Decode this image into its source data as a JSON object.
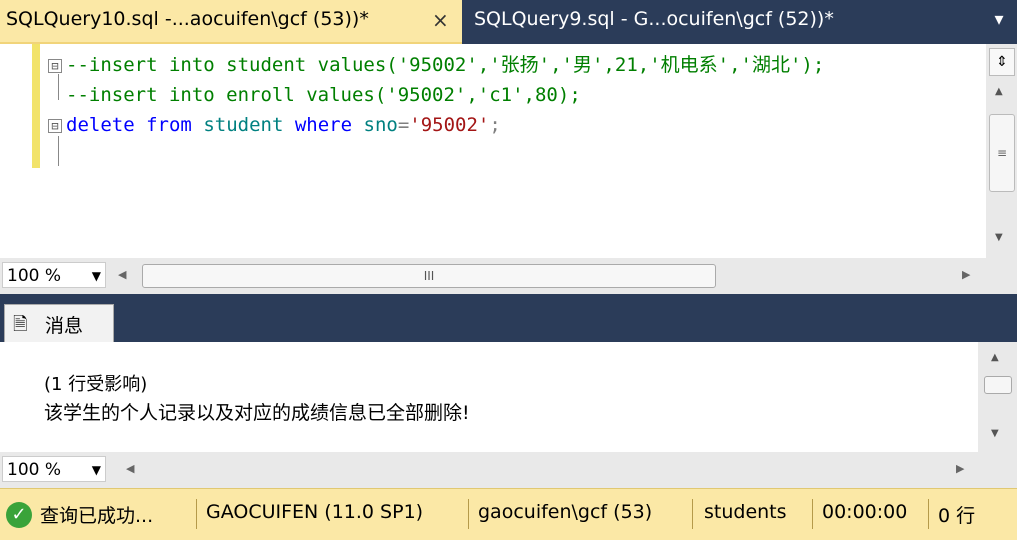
{
  "tabs": {
    "active": "SQLQuery10.sql -...aocuifen\\gcf (53))*",
    "close_icon": "×",
    "inactive": "SQLQuery9.sql - G...ocuifen\\gcf (52))*",
    "menu_icon": "▾"
  },
  "editor": {
    "lines": [
      {
        "fold": "⊟",
        "text": "--insert into student values('95002','张扬','男',21,'机电系','湖北');"
      },
      {
        "text": "--insert into enroll values('95002','c1',80);"
      },
      {
        "fold": "⊟",
        "kw1": "delete",
        "kw2": "from",
        "obj": "student",
        "kw3": "where",
        "obj2": "sno",
        "eq": "=",
        "str": "'95002'",
        "semi": ";"
      }
    ]
  },
  "zoom": {
    "editor": "100 %",
    "results": "100 %"
  },
  "results": {
    "tab_label": "消息",
    "messages": [
      "(1 行受影响)",
      "该学生的个人记录以及对应的成绩信息已全部删除!"
    ]
  },
  "status": {
    "query_state": "查询已成功...",
    "server": "GAOCUIFEN (11.0 SP1)",
    "login": "gaocuifen\\gcf (53)",
    "database": "students",
    "elapsed": "00:00:00",
    "rows": "0 行"
  },
  "colors": {
    "tab_active": "#fbe8a6",
    "chrome": "#2b3c59",
    "keyword": "#0000ff",
    "comment": "#007f00",
    "string": "#a31515"
  }
}
